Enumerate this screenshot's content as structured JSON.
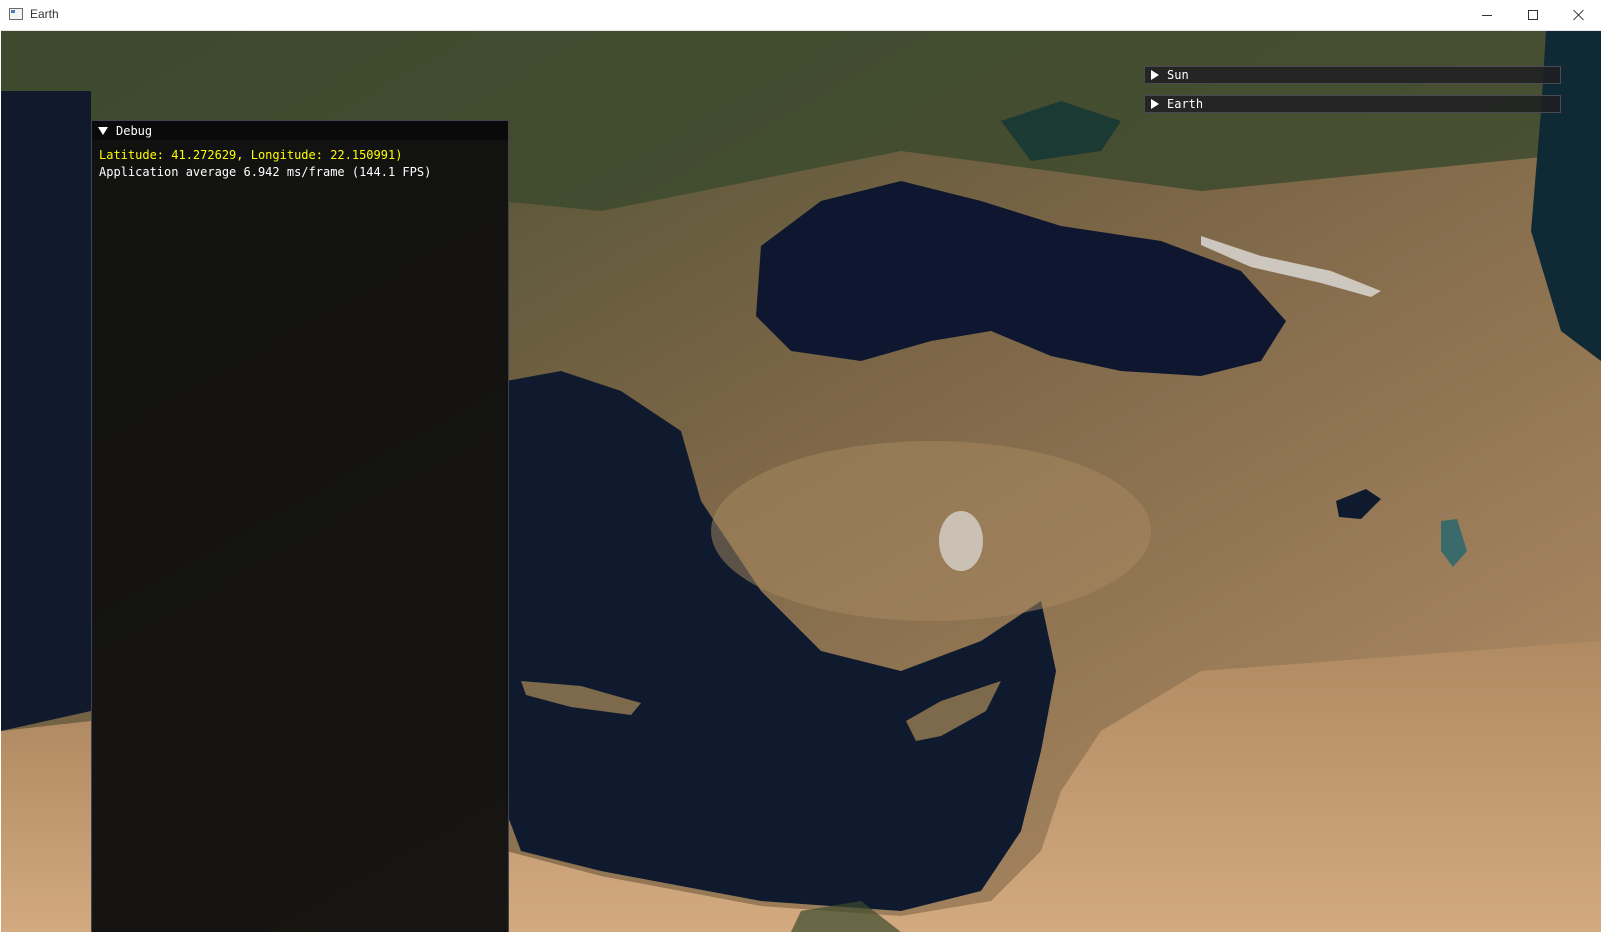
{
  "window": {
    "title": "Earth",
    "icon": "app-window-icon",
    "controls": [
      "minimize-icon",
      "maximize-icon",
      "close-icon"
    ]
  },
  "debug": {
    "title": "Debug",
    "coordinates": "Latitude: 41.272629, Longitude: 22.150991)",
    "perf": "Application average 6.942 ms/frame (144.1 FPS)"
  },
  "panels": [
    {
      "label": "Sun"
    },
    {
      "label": "Earth"
    }
  ],
  "colors": {
    "sea": "#0f1626",
    "land": "#8a7250",
    "highlight_text": "#ffff00",
    "panel_bg": "#0f0f0f"
  }
}
